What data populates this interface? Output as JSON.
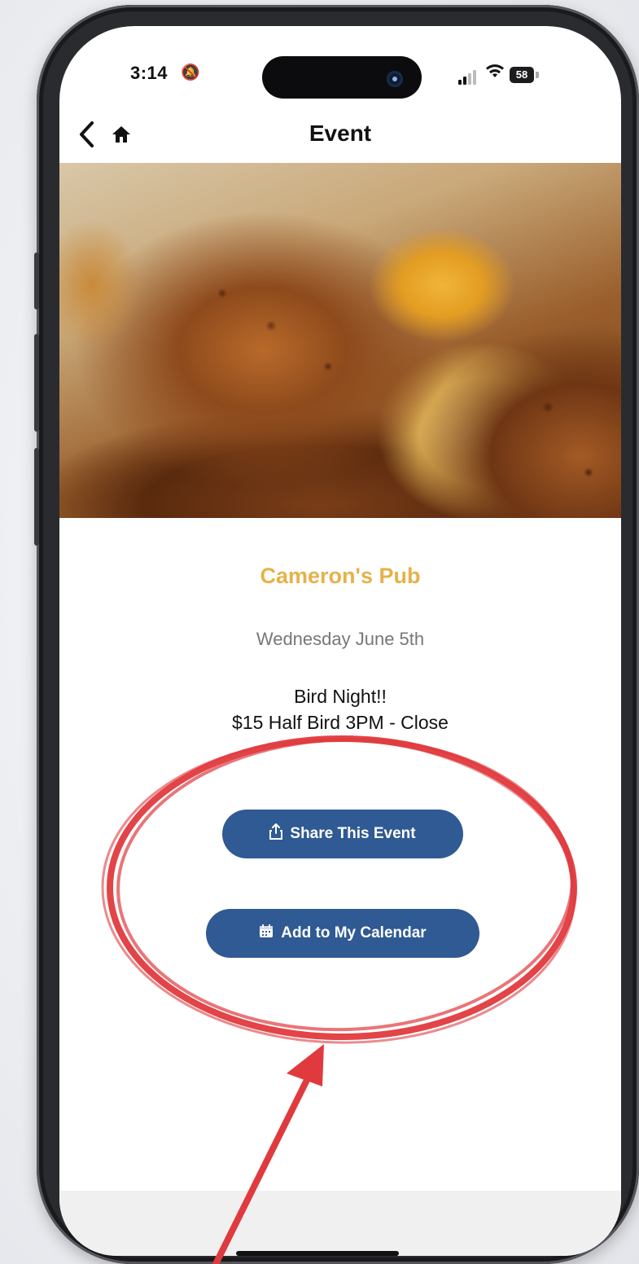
{
  "status_bar": {
    "time": "3:14",
    "battery": "58",
    "icons": [
      "bell-slash-icon",
      "signal-icon",
      "wifi-icon",
      "battery-icon"
    ]
  },
  "nav": {
    "title": "Event",
    "back_icon": "chevron-left-icon",
    "home_icon": "home-icon"
  },
  "event": {
    "venue": "Cameron's Pub",
    "date": "Wednesday June 5th",
    "description_line1": "Bird Night!!",
    "description_line2": "$15 Half Bird 3PM - Close"
  },
  "actions": {
    "share_label": "Share This Event",
    "calendar_label": "Add to My Calendar",
    "share_icon": "share-icon",
    "calendar_icon": "calendar-icon"
  },
  "colors": {
    "venue_gold": "#e5b249",
    "button_blue": "#2f5a93",
    "annotation_red": "#e03a3e"
  }
}
